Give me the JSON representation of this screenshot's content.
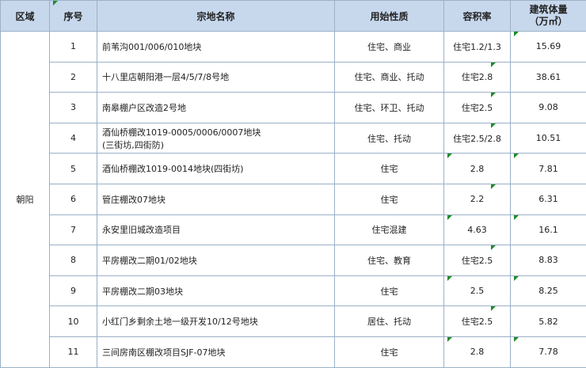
{
  "headers": {
    "district": "区域",
    "index": "序号",
    "name": "宗地名称",
    "use": "用始性质",
    "far": "容积率",
    "volume_line1": "建筑体量",
    "volume_line2": "（万㎡）"
  },
  "district": "朝阳",
  "rows": [
    {
      "no": "1",
      "name": "前苇沟001/006/010地块",
      "use": "住宅、商业",
      "far": "住宅1.2/1.3",
      "vol": "15.69"
    },
    {
      "no": "2",
      "name": "十八里店朝阳港一层4/5/7/8号地",
      "use": "住宅、商业、托动",
      "far": "住宅2.8",
      "vol": "38.61"
    },
    {
      "no": "3",
      "name": "南皋棚户区改造2号地",
      "use": "住宅、环卫、托动",
      "far": "住宅2.5",
      "vol": "9.08"
    },
    {
      "no": "4",
      "name_line1": "酒仙桥棚改1019-0005/0006/0007地块",
      "name_line2": "(三街坊,四街防)",
      "use": "住宅、托动",
      "far": "住宅2.5/2.8",
      "vol": "10.51"
    },
    {
      "no": "5",
      "name": "酒仙桥棚改1019-0014地块(四街坊)",
      "use": "住宅",
      "far": "2.8",
      "vol": "7.81"
    },
    {
      "no": "6",
      "name": "管庄棚改07地块",
      "use": "住宅",
      "far": "2.2",
      "vol": "6.31"
    },
    {
      "no": "7",
      "name": "永安里旧城改造项目",
      "use": "住宅混建",
      "far": "4.63",
      "vol": "16.1"
    },
    {
      "no": "8",
      "name": "平房棚改二期01/02地块",
      "use": "住宅、教育",
      "far": "住宅2.5",
      "vol": "8.83"
    },
    {
      "no": "9",
      "name": "平房棚改二期03地块",
      "use": "住宅",
      "far": "2.5",
      "vol": "8.25"
    },
    {
      "no": "10",
      "name": "小红门乡剩余土地一级开发10/12号地块",
      "use": "居住、托动",
      "far": "住宅2.5",
      "vol": "5.82"
    },
    {
      "no": "11",
      "name": "三间房南区棚改项目SJF-07地块",
      "use": "住宅",
      "far": "2.8",
      "vol": "7.78"
    }
  ]
}
